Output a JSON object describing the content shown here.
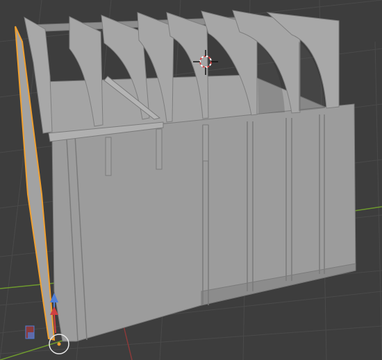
{
  "viewport": {
    "background": "#3d3d3d",
    "grid_color": "#4a4a4a",
    "x_axis_color": "#8a3a3a",
    "y_axis_color": "#6e9a2e",
    "model_color": "#9b9b9b",
    "model_shade_color": "#8a8a8a",
    "model_edge_color": "#7a7a7a",
    "selection_color": "#f0a030"
  },
  "scene": {
    "object": "wall-model-with-arched-fins",
    "selected_object": "left-edge-panel",
    "cursor": "3d-cursor-icon",
    "origin": "object-origin-icon",
    "gizmo": {
      "z_arrow_color": "#4f7fd8",
      "x_arrow_color": "#d04040",
      "widget_icon": "transform-widget-icon"
    }
  }
}
